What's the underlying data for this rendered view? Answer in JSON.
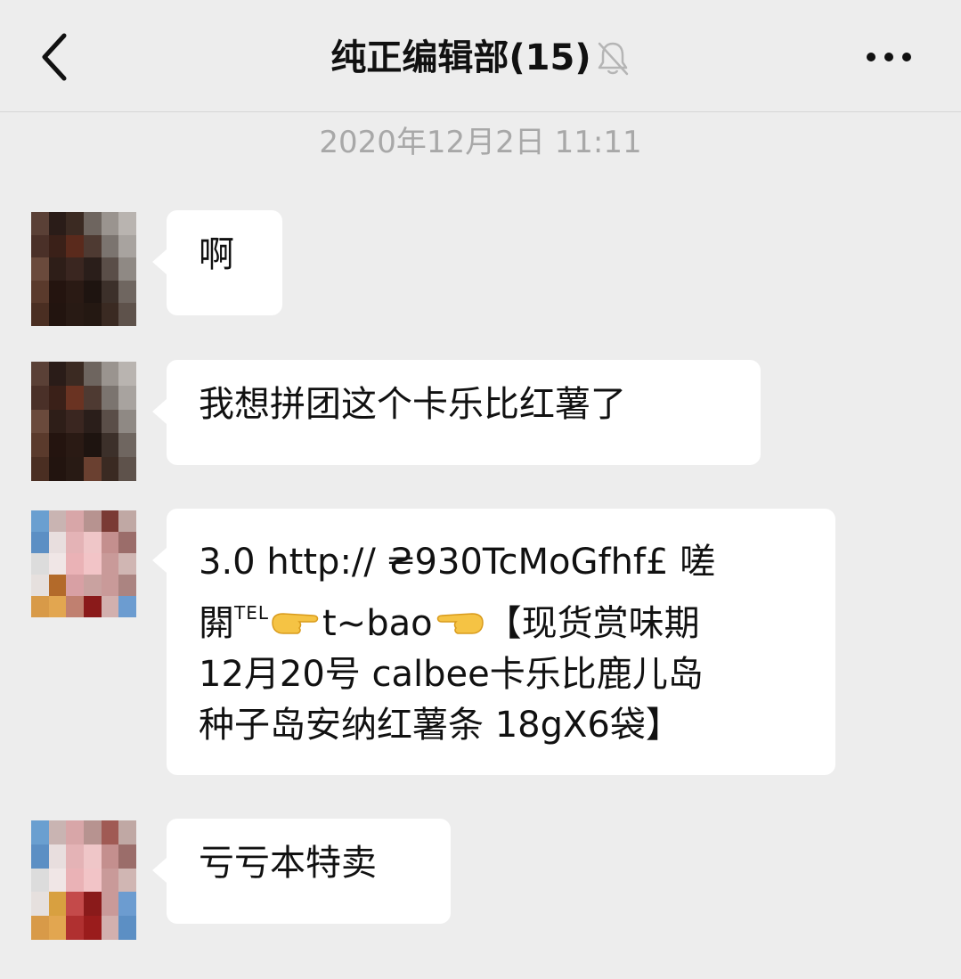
{
  "header": {
    "title": "纯正编辑部",
    "member_count": "(15)",
    "muted": true,
    "back_icon": "chevron-left-icon",
    "more_icon": "more-dots-icon"
  },
  "timestamp": "2020年12月2日 11:11",
  "messages": [
    {
      "sender_avatar": "pixelated-photo",
      "lines": [
        "啊"
      ]
    },
    {
      "sender_avatar": "pixelated-photo",
      "lines": [
        "我想拼团这个卡乐比红薯了"
      ]
    },
    {
      "sender_avatar": "pixelated-cartoon",
      "line1": "3.0 http:// ₴930TcMoGfhf£ 嗟",
      "line2_a": "閞",
      "line2_sup": "TEL",
      "line2_b": "t~bao",
      "line2_c": "【现货赏味期",
      "line3": "12月20号 calbee卡乐比鹿儿岛",
      "line4": "种子岛安纳红薯条 18gX6袋】"
    },
    {
      "sender_avatar": "pixelated-cartoon",
      "lines": [
        "亏亏本特卖"
      ]
    }
  ],
  "colors": {
    "background": "#ededed",
    "bubble": "#ffffff",
    "timestamp": "#a8a8a8",
    "emoji_hand": "#f5c344"
  }
}
